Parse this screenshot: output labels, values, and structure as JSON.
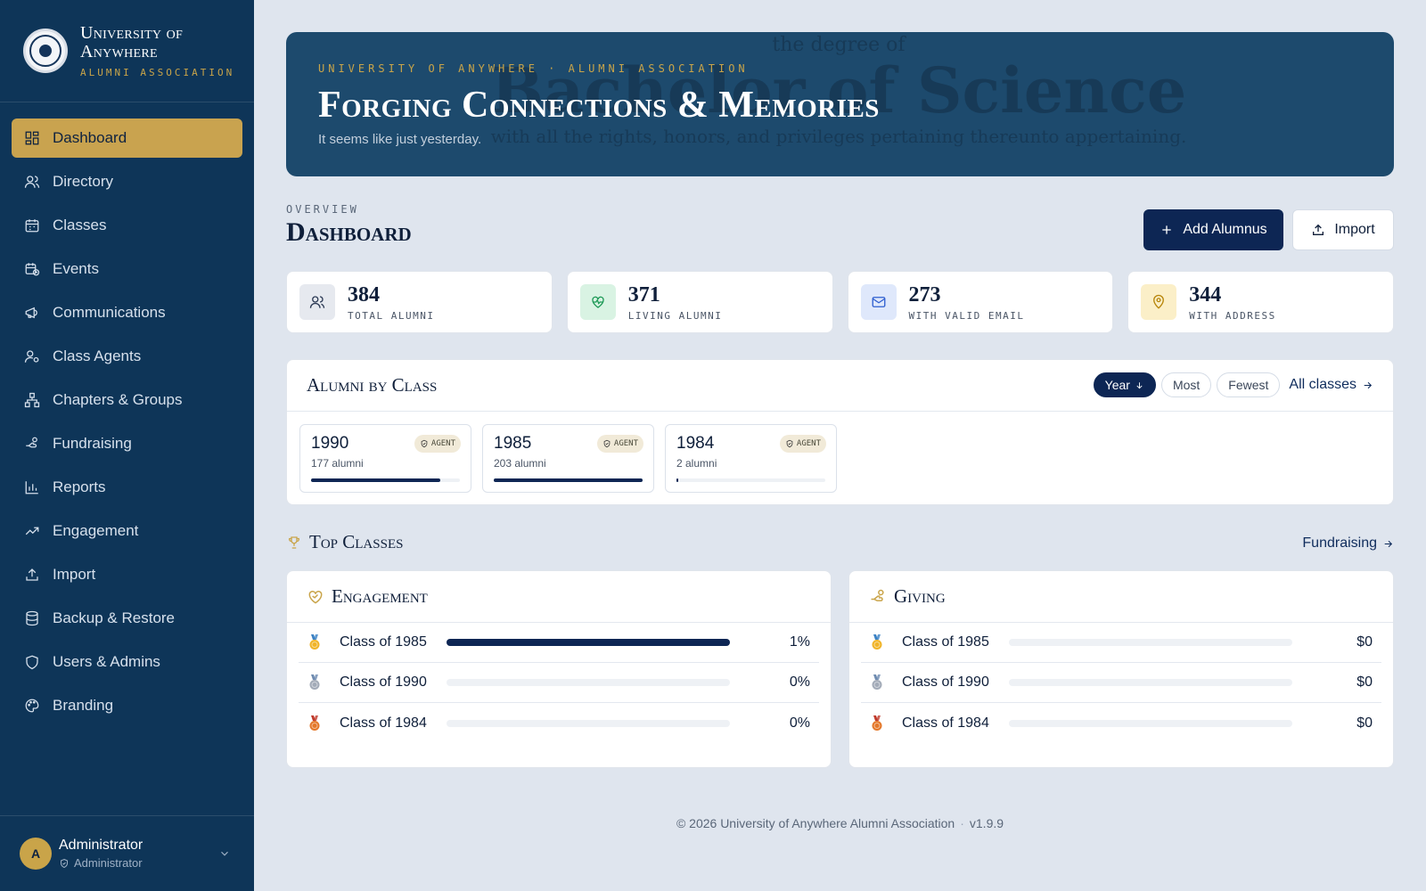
{
  "brand": {
    "line1": "University of",
    "line2": "Anywhere",
    "sub": "ALUMNI ASSOCIATION"
  },
  "nav": [
    {
      "label": "Dashboard",
      "icon": "dashboard-icon",
      "active": true
    },
    {
      "label": "Directory",
      "icon": "users-icon"
    },
    {
      "label": "Classes",
      "icon": "calendar-icon"
    },
    {
      "label": "Events",
      "icon": "calendar-clock-icon"
    },
    {
      "label": "Communications",
      "icon": "megaphone-icon"
    },
    {
      "label": "Class Agents",
      "icon": "user-cog-icon"
    },
    {
      "label": "Chapters & Groups",
      "icon": "network-icon"
    },
    {
      "label": "Fundraising",
      "icon": "hand-coins-icon"
    },
    {
      "label": "Reports",
      "icon": "bar-chart-icon"
    },
    {
      "label": "Engagement",
      "icon": "trending-up-icon"
    },
    {
      "label": "Import",
      "icon": "upload-icon"
    },
    {
      "label": "Backup & Restore",
      "icon": "database-icon"
    },
    {
      "label": "Users & Admins",
      "icon": "shield-icon"
    },
    {
      "label": "Branding",
      "icon": "palette-icon"
    }
  ],
  "user": {
    "initial": "A",
    "name": "Administrator",
    "role": "Administrator"
  },
  "hero": {
    "eyebrow": "UNIVERSITY OF ANYWHERE · ALUMNI ASSOCIATION",
    "title": "Forging Connections & Memories",
    "subtitle": "It seems like just yesterday."
  },
  "overview": {
    "eyebrow": "OVERVIEW",
    "title": "Dashboard"
  },
  "actions": {
    "add": "Add Alumnus",
    "import": "Import"
  },
  "stats": [
    {
      "value": "384",
      "label": "TOTAL ALUMNI",
      "icon": "users-icon",
      "bg": "#e6e9ef",
      "stroke": "#2c3a55"
    },
    {
      "value": "371",
      "label": "LIVING ALUMNI",
      "icon": "heart-pulse-icon",
      "bg": "#d9f3e3",
      "stroke": "#1f9a57"
    },
    {
      "value": "273",
      "label": "WITH VALID EMAIL",
      "icon": "mail-icon",
      "bg": "#dfe8fb",
      "stroke": "#2f5fd0"
    },
    {
      "value": "344",
      "label": "WITH ADDRESS",
      "icon": "map-pin-icon",
      "bg": "#fbefc8",
      "stroke": "#b8860b"
    }
  ],
  "alumni_by_class": {
    "title": "Alumni by Class",
    "sort_year": "Year",
    "sort_most": "Most",
    "sort_fewest": "Fewest",
    "all_link": "All classes",
    "classes": [
      {
        "year": "1990",
        "count": "177 alumni",
        "badge": "AGENT",
        "fill": 0.87
      },
      {
        "year": "1985",
        "count": "203 alumni",
        "badge": "AGENT",
        "fill": 1.0
      },
      {
        "year": "1984",
        "count": "2 alumni",
        "badge": "AGENT",
        "fill": 0.01
      }
    ]
  },
  "top_classes": {
    "title": "Top Classes",
    "link": "Fundraising",
    "engagement": {
      "title": "Engagement",
      "rows": [
        {
          "medal": "gold",
          "label": "Class of 1985",
          "value": "1%",
          "fill": 1.0
        },
        {
          "medal": "silver",
          "label": "Class of 1990",
          "value": "0%",
          "fill": 0
        },
        {
          "medal": "bronze",
          "label": "Class of 1984",
          "value": "0%",
          "fill": 0
        }
      ]
    },
    "giving": {
      "title": "Giving",
      "rows": [
        {
          "medal": "gold",
          "label": "Class of 1985",
          "value": "$0",
          "fill": 0
        },
        {
          "medal": "silver",
          "label": "Class of 1990",
          "value": "$0",
          "fill": 0
        },
        {
          "medal": "bronze",
          "label": "Class of 1984",
          "value": "$0",
          "fill": 0
        }
      ]
    }
  },
  "footer": {
    "copyright": "© 2026 University of Anywhere Alumni Association",
    "version": "v1.9.9"
  },
  "colors": {
    "sidebar": "#0e3558",
    "accent_gold": "#c9a34f",
    "primary_navy": "#0d2654",
    "background": "#dfe5ee"
  }
}
